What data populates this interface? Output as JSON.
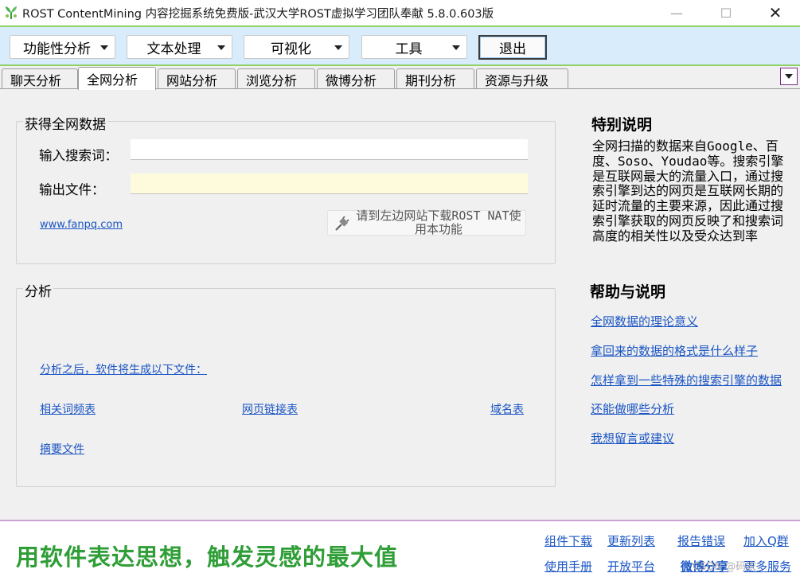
{
  "window": {
    "title": "ROST ContentMining 内容挖掘系统免费版-武汉大学ROST虚拟学习团队奉献  5.8.0.603版",
    "minimize": "—",
    "maximize": "☐",
    "close": "✕"
  },
  "menu": {
    "items": [
      "功能性分析",
      "文本处理",
      "可视化",
      "工具"
    ],
    "exit_label": "退出"
  },
  "tabs": {
    "items": [
      "聊天分析",
      "全网分析",
      "网站分析",
      "浏览分析",
      "微博分析",
      "期刊分析",
      "资源与升级"
    ],
    "active": "全网分析"
  },
  "fetch_group": {
    "title": "获得全网数据",
    "search_label": "输入搜索词：",
    "search_value": "",
    "output_label": "输出文件：",
    "output_value": "",
    "site_link": "www.fanpq.com",
    "note": "请到左边网站下载ROST NAT使用本功能"
  },
  "analysis_group": {
    "title": "分析",
    "intro_link": "分析之后，软件将生成以下文件：",
    "files": [
      "相关词频表",
      "网页链接表",
      "域名表",
      "摘要文件"
    ]
  },
  "sidebar": {
    "special_title": "特别说明",
    "special_text": "全网扫描的数据来自Google、百度、Soso、Youdao等。搜索引擎是互联网最大的流量入口，通过搜索引擎到达的网页是互联网长期的延时流量的主要来源，因此通过搜索引擎获取的网页反映了和搜索词高度的相关性以及受众达到率",
    "help_title": "帮助与说明",
    "help_links": [
      "全网数据的理论意义",
      "拿回来的数据的格式是什么样子",
      "怎样拿到一些特殊的搜索引擎的数据",
      "还能做哪些分析",
      "我想留言或建议"
    ]
  },
  "footer": {
    "slogan": "用软件表达思想，触发灵感的最大值",
    "links_row1": [
      "组件下载",
      "更新列表",
      "报告错误",
      "加入Q群"
    ],
    "links_row2": [
      "使用手册",
      "开放平台",
      "微博分享",
      "更多服务"
    ],
    "watermark": "CSDN @码农"
  },
  "colors": {
    "menu_bg": "#d9ecfb",
    "menu_border": "#8fd16a",
    "link": "#1a55c4",
    "slogan": "#2f9e37",
    "output_field_bg": "#fefbdc"
  }
}
